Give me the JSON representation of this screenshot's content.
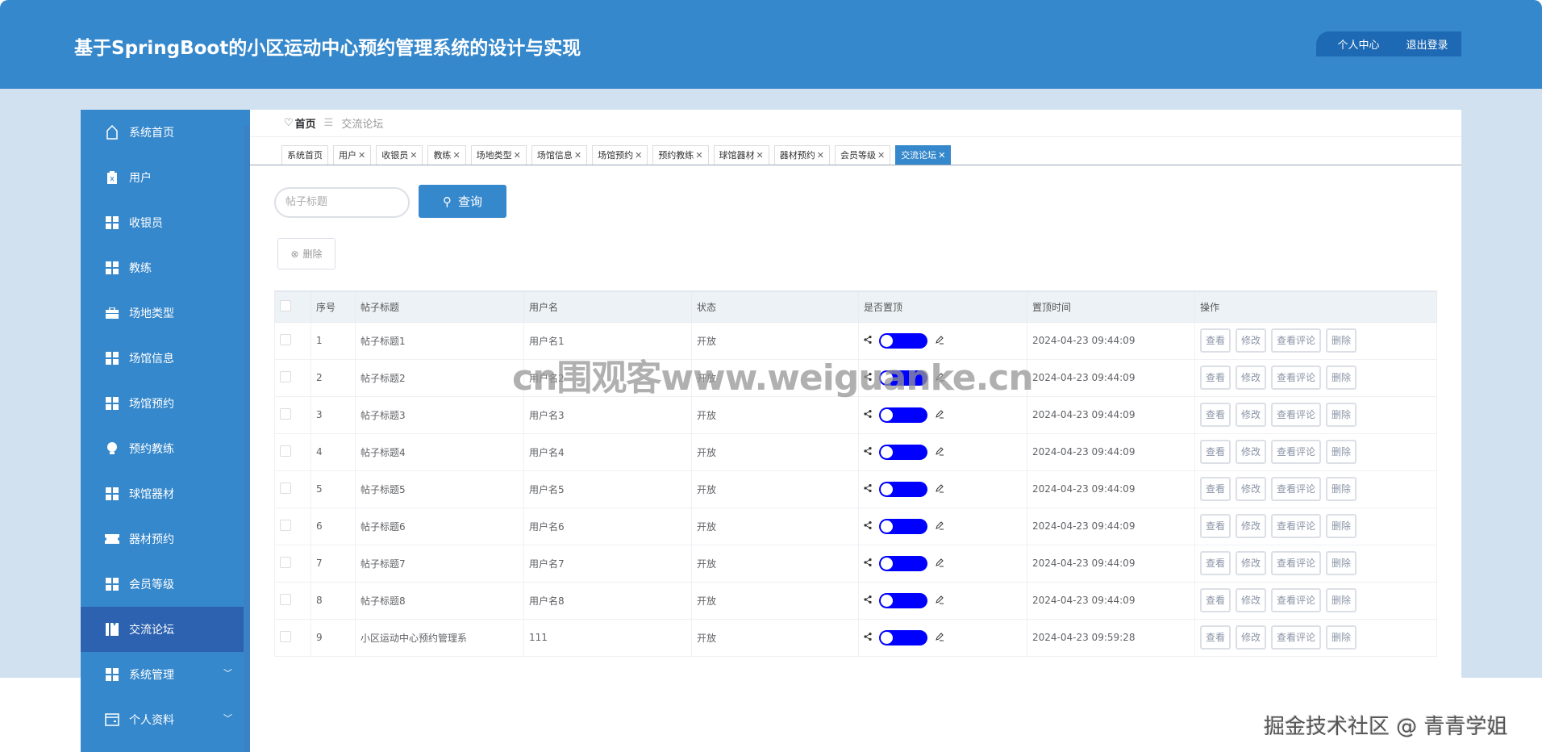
{
  "header": {
    "title": "基于SpringBoot的小区运动中心预约管理系统的设计与实现",
    "profile": "个人中心",
    "logout": "退出登录"
  },
  "sidebar": {
    "items": [
      {
        "label": "系统首页",
        "icon": "home-icon"
      },
      {
        "label": "用户",
        "icon": "clipboard-icon"
      },
      {
        "label": "收银员",
        "icon": "grid-icon"
      },
      {
        "label": "教练",
        "icon": "grid-icon"
      },
      {
        "label": "场地类型",
        "icon": "briefcase-icon"
      },
      {
        "label": "场馆信息",
        "icon": "grid-icon"
      },
      {
        "label": "场馆预约",
        "icon": "grid-icon"
      },
      {
        "label": "预约教练",
        "icon": "bulb-icon"
      },
      {
        "label": "球馆器材",
        "icon": "grid-icon"
      },
      {
        "label": "器材预约",
        "icon": "ticket-icon"
      },
      {
        "label": "会员等级",
        "icon": "grid-icon"
      },
      {
        "label": "交流论坛",
        "icon": "book-icon",
        "active": true
      },
      {
        "label": "系统管理",
        "icon": "grid-icon",
        "expandable": true
      },
      {
        "label": "个人资料",
        "icon": "wallet-icon",
        "expandable": true
      }
    ]
  },
  "breadcrumb": {
    "home": "首页",
    "sep": "☰",
    "current": "交流论坛"
  },
  "tabs": [
    {
      "label": "系统首页",
      "closable": false
    },
    {
      "label": "用户",
      "closable": true
    },
    {
      "label": "收银员",
      "closable": true
    },
    {
      "label": "教练",
      "closable": true
    },
    {
      "label": "场地类型",
      "closable": true
    },
    {
      "label": "场馆信息",
      "closable": true
    },
    {
      "label": "场馆预约",
      "closable": true
    },
    {
      "label": "预约教练",
      "closable": true
    },
    {
      "label": "球馆器材",
      "closable": true
    },
    {
      "label": "器材预约",
      "closable": true
    },
    {
      "label": "会员等级",
      "closable": true
    },
    {
      "label": "交流论坛",
      "closable": true,
      "active": true
    }
  ],
  "close_glyph": "✕",
  "search": {
    "placeholder": "帖子标题",
    "button": "查询"
  },
  "toolbar": {
    "delete": "删除"
  },
  "table": {
    "headers": [
      "序号",
      "帖子标题",
      "用户名",
      "状态",
      "是否置顶",
      "置顶时间",
      "操作"
    ],
    "rows": [
      {
        "no": "1",
        "title": "帖子标题1",
        "user": "用户名1",
        "status": "开放",
        "pinned": false,
        "time": "2024-04-23 09:44:09"
      },
      {
        "no": "2",
        "title": "帖子标题2",
        "user": "用户名2",
        "status": "开放",
        "pinned": false,
        "time": "2024-04-23 09:44:09"
      },
      {
        "no": "3",
        "title": "帖子标题3",
        "user": "用户名3",
        "status": "开放",
        "pinned": false,
        "time": "2024-04-23 09:44:09"
      },
      {
        "no": "4",
        "title": "帖子标题4",
        "user": "用户名4",
        "status": "开放",
        "pinned": false,
        "time": "2024-04-23 09:44:09"
      },
      {
        "no": "5",
        "title": "帖子标题5",
        "user": "用户名5",
        "status": "开放",
        "pinned": false,
        "time": "2024-04-23 09:44:09"
      },
      {
        "no": "6",
        "title": "帖子标题6",
        "user": "用户名6",
        "status": "开放",
        "pinned": false,
        "time": "2024-04-23 09:44:09"
      },
      {
        "no": "7",
        "title": "帖子标题7",
        "user": "用户名7",
        "status": "开放",
        "pinned": false,
        "time": "2024-04-23 09:44:09"
      },
      {
        "no": "8",
        "title": "帖子标题8",
        "user": "用户名8",
        "status": "开放",
        "pinned": false,
        "time": "2024-04-23 09:44:09"
      },
      {
        "no": "9",
        "title": "小区运动中心预约管理系",
        "user": "111",
        "status": "开放",
        "pinned": false,
        "time": "2024-04-23 09:59:28"
      }
    ],
    "actions": [
      "查看",
      "修改",
      "查看评论",
      "删除"
    ]
  },
  "watermarks": {
    "center": "cn围观客www.weiguanke.cn",
    "corner": "掘金技术社区 @ 青青学姐"
  },
  "colors": {
    "primary": "#3688cc",
    "active_nav": "#2c62b0",
    "toggle": "#0000ff",
    "background": "#d2e1f0"
  }
}
